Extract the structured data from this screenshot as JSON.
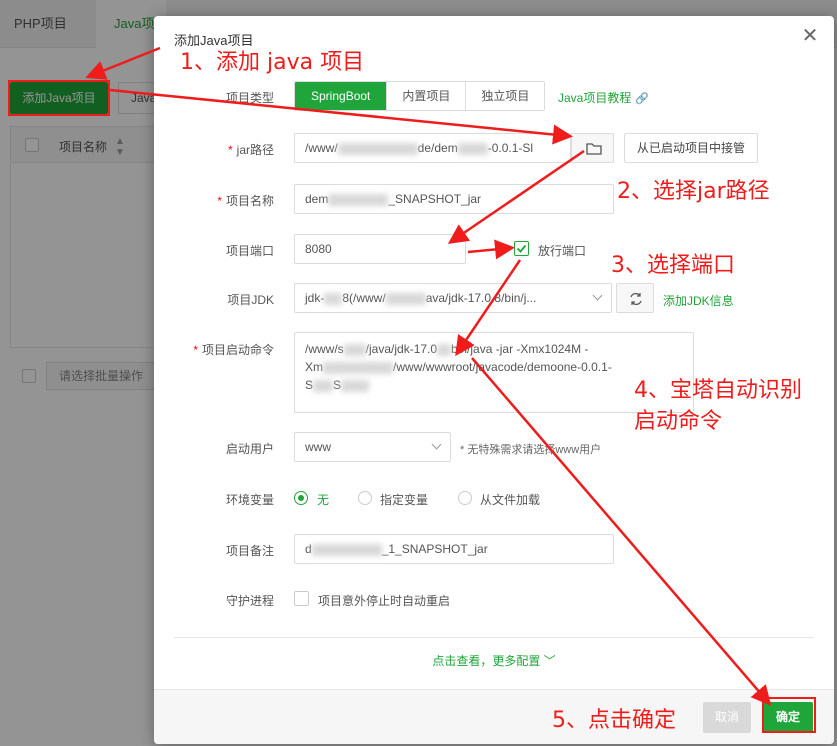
{
  "background": {
    "tabs": [
      "PHP项目",
      "Java项"
    ],
    "add_button": "添加Java项目",
    "second_button": "Java",
    "table_header": "项目名称",
    "batch_placeholder": "请选择批量操作"
  },
  "dialog": {
    "title": "添加Java项目",
    "project_type": {
      "label": "项目类型",
      "options": [
        "SpringBoot",
        "内置项目",
        "独立项目"
      ],
      "selected": "SpringBoot",
      "tutorial_link": "Java项目教程"
    },
    "jar_path": {
      "label": "jar路径",
      "value_start": "/www/",
      "value_mid": "de/dem",
      "value_end": "-0.0.1-Sl",
      "takeover_button": "从已启动项目中接管"
    },
    "project_name": {
      "label": "项目名称",
      "value_start": "dem",
      "value_end": "_SNAPSHOT_jar"
    },
    "project_port": {
      "label": "项目端口",
      "value": "8080",
      "open_port_label": "放行端口",
      "open_port_checked": true
    },
    "project_jdk": {
      "label": "项目JDK",
      "value_start": "jdk-",
      "value_mid": "8(/www/",
      "value_end": "ava/jdk-17.0.8/bin/j...",
      "add_jdk_link": "添加JDK信息"
    },
    "start_command": {
      "label": "项目启动命令",
      "line1_start": "/www/s",
      "line1_end": "/java/jdk-17.0",
      "line1_tail": "bin/java -jar  -Xmx1024M -",
      "line2_start": "Xm",
      "line2_end": "/www/wwwroot/javacode/demoone-0.0.1-",
      "line3_start": "S",
      "line3_end": "S"
    },
    "run_user": {
      "label": "启动用户",
      "value": "www",
      "hint": "* 无特殊需求请选择www用户"
    },
    "env_vars": {
      "label": "环境变量",
      "options": [
        "无",
        "指定变量",
        "从文件加载"
      ],
      "selected": "无"
    },
    "remark": {
      "label": "项目备注",
      "value_start": "d",
      "value_end": "_1_SNAPSHOT_jar"
    },
    "daemon": {
      "label": "守护进程",
      "checkbox_label": "项目意外停止时自动重启",
      "checked": false
    },
    "more_config": "点击查看，更多配置",
    "cancel_button": "取消",
    "confirm_button": "确定"
  },
  "annotations": {
    "step1": "1、添加 java 项目",
    "step2": "2、选择jar路径",
    "step3": "3、选择端口",
    "step4_line1": "4、宝塔自动识别",
    "step4_line2": "启动命令",
    "step5": "5、点击确定"
  },
  "colors": {
    "brand_green": "#20a53a",
    "annotation_red": "#ef1c1c",
    "required_red": "#ef0808"
  }
}
